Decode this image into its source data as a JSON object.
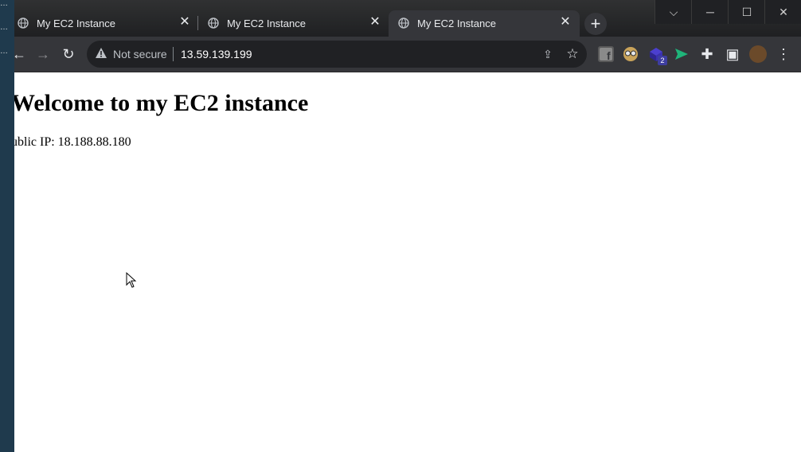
{
  "tabs": [
    {
      "title": "My EC2 Instance",
      "active": false
    },
    {
      "title": "My EC2 Instance",
      "active": false
    },
    {
      "title": "My EC2 Instance",
      "active": true
    }
  ],
  "address_bar": {
    "security_label": "Not secure",
    "url": "13.59.139.199"
  },
  "extensions": {
    "badge_count": "2"
  },
  "page": {
    "heading": "Welcome to my EC2 instance",
    "public_ip_text": "ublic IP: 18.188.88.180"
  },
  "colors": {
    "tabbar": "#202124",
    "toolbar": "#35363a",
    "omnibox": "#202124",
    "left_strip": "#1f3a4d"
  }
}
